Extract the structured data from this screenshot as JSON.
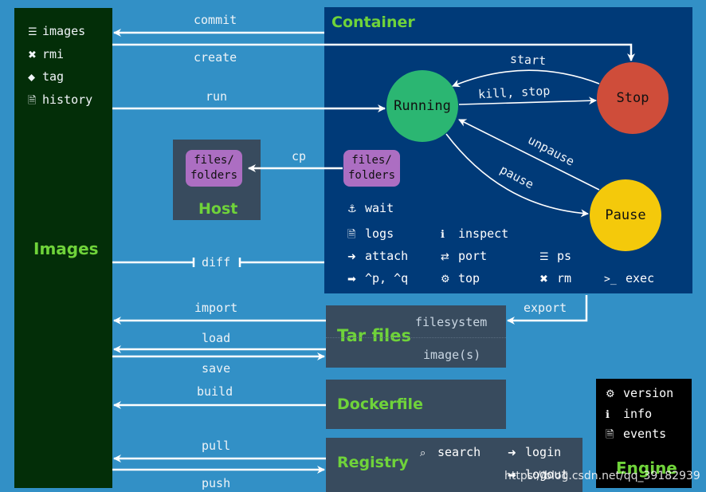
{
  "images_panel": {
    "title": "Images",
    "commands": [
      {
        "icon": "list-icon",
        "glyph": "☰",
        "label": "images"
      },
      {
        "icon": "close-icon",
        "glyph": "✖",
        "label": "rmi"
      },
      {
        "icon": "tag-icon",
        "glyph": "⬥",
        "label": "tag"
      },
      {
        "icon": "file-icon",
        "glyph": "🗎",
        "label": "history"
      }
    ]
  },
  "container_panel": {
    "title": "Container",
    "states": {
      "running": "Running",
      "stop": "Stop",
      "pause": "Pause"
    },
    "transitions": {
      "start": "start",
      "kill_stop": "kill, stop",
      "unpause": "unpause",
      "pause": "pause"
    },
    "files_label_line1": "files/",
    "files_label_line2": "folders",
    "commands": [
      {
        "icon": "anchor-icon",
        "glyph": "⚓",
        "label": "wait"
      },
      {
        "icon": "file-icon",
        "glyph": "🗎",
        "label": "logs"
      },
      {
        "icon": "info-icon",
        "glyph": "ℹ",
        "label": "inspect"
      },
      {
        "icon": "sign-in-icon",
        "glyph": "➜",
        "label": "attach"
      },
      {
        "icon": "exchange-icon",
        "glyph": "⇄",
        "label": "port"
      },
      {
        "icon": "list-icon",
        "glyph": "☰",
        "label": "ps"
      },
      {
        "icon": "sign-out-icon",
        "glyph": "➡",
        "label": "^p, ^q"
      },
      {
        "icon": "gears-icon",
        "glyph": "⚙",
        "label": "top"
      },
      {
        "icon": "close-icon",
        "glyph": "✖",
        "label": "rm"
      },
      {
        "icon": "terminal-icon",
        "glyph": ">_",
        "label": "exec"
      }
    ],
    "colors": {
      "running": "#2bb672",
      "stop": "#cf4d3a",
      "pause": "#f4c90b"
    }
  },
  "host_panel": {
    "title": "Host",
    "files_label_line1": "files/",
    "files_label_line2": "folders"
  },
  "arrows": {
    "commit": "commit",
    "create": "create",
    "run": "run",
    "cp": "cp",
    "diff": "diff",
    "import": "import",
    "load": "load",
    "save": "save",
    "build": "build",
    "pull": "pull",
    "push": "push",
    "export": "export"
  },
  "tar_panel": {
    "title": "Tar files",
    "filesystem": "filesystem",
    "images": "image(s)"
  },
  "dockerfile_panel": {
    "title": "Dockerfile"
  },
  "registry_panel": {
    "title": "Registry",
    "search": "search",
    "login": "login",
    "logout": "logout"
  },
  "engine_panel": {
    "title": "Engine",
    "commands": [
      {
        "icon": "gear-icon",
        "glyph": "⚙",
        "label": "version"
      },
      {
        "icon": "info-icon",
        "glyph": "ℹ",
        "label": "info"
      },
      {
        "icon": "file-icon",
        "glyph": "🗎",
        "label": "events"
      }
    ]
  },
  "watermark": "https://blog.csdn.net/qq_39182939"
}
